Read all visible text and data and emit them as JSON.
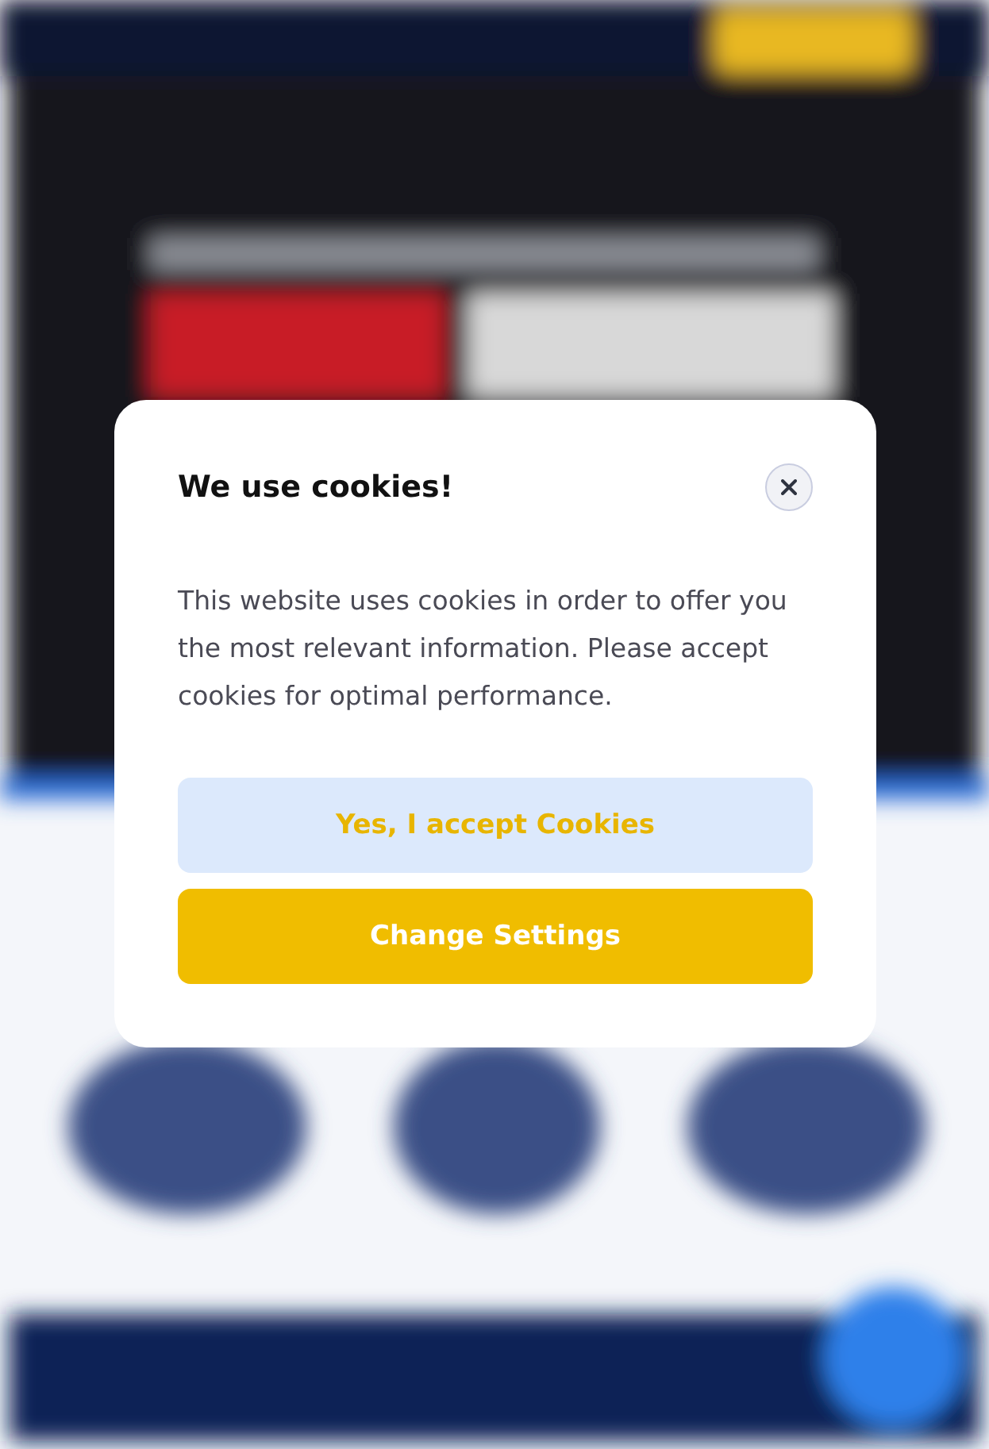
{
  "cookie_dialog": {
    "title": "We use cookies!",
    "message": "This website uses cookies in order to offer you the most relevant information. Please accept cookies for optimal performance.",
    "buttons": [
      {
        "label": "Yes, I accept Cookies",
        "kind": "secondary"
      },
      {
        "label": "Change Settings",
        "kind": "primary"
      }
    ]
  }
}
